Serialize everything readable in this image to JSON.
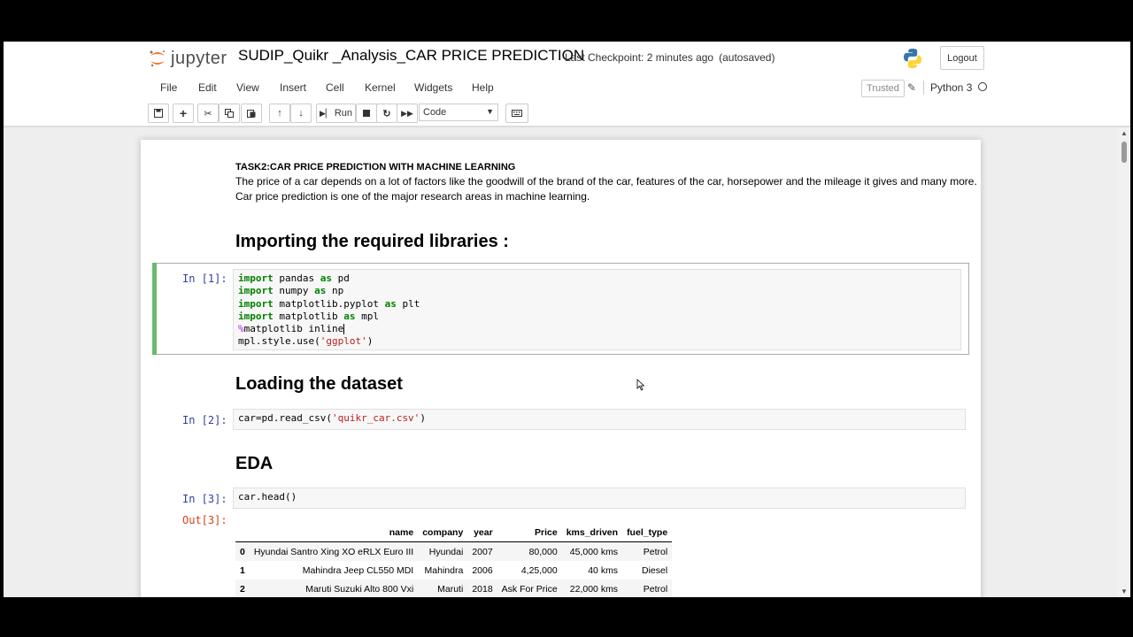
{
  "header": {
    "logo_text": "jupyter",
    "notebook_title": "SUDIP_Quikr _Analysis_CAR PRICE PREDICTION",
    "checkpoint": "Last Checkpoint: 2 minutes ago",
    "autosave": "(autosaved)",
    "logout_label": "Logout"
  },
  "menubar": {
    "items": [
      "File",
      "Edit",
      "View",
      "Insert",
      "Cell",
      "Kernel",
      "Widgets",
      "Help"
    ],
    "trusted_label": "Trusted",
    "kernel_name": "Python 3"
  },
  "toolbar": {
    "run_label": "Run",
    "cell_type": "Code"
  },
  "notebook": {
    "task_heading": "TASK2:CAR PRICE PREDICTION WITH MACHINE LEARNING",
    "intro_line1": "The price of a car depends on a lot of factors like the goodwill of the brand of the car, features of the car, horsepower and the mileage it gives and many more.",
    "intro_line2": "Car price prediction is one of the major research areas in machine learning.",
    "section1": "Importing the required libraries :",
    "section2": "Loading the dataset",
    "section3": "EDA",
    "cells": [
      {
        "prompt": "In [1]:"
      },
      {
        "prompt": "In [2]:"
      },
      {
        "prompt": "In [3]:"
      }
    ],
    "out_prompt": "Out[3]:",
    "code1": {
      "l1_kw1": "import",
      "l1_mod": " pandas ",
      "l1_kw2": "as",
      "l1_alias": " pd",
      "l2_kw1": "import",
      "l2_mod": " numpy ",
      "l2_kw2": "as",
      "l2_alias": " np",
      "l3_kw1": "import",
      "l3_mod": " matplotlib.pyplot ",
      "l3_kw2": "as",
      "l3_alias": " plt",
      "l4_kw1": "import",
      "l4_mod": " matplotlib ",
      "l4_kw2": "as",
      "l4_alias": " mpl",
      "l5_magic": "%",
      "l5_rest": "matplotlib inline",
      "l6_pre": "mpl.style.use(",
      "l6_str": "'ggplot'",
      "l6_post": ")"
    },
    "code2": {
      "pre": "car=pd.read_csv(",
      "str": "'quikr_car.csv'",
      "post": ")"
    },
    "code3": {
      "text": "car.head()"
    }
  },
  "dataframe": {
    "columns": [
      "",
      "name",
      "company",
      "year",
      "Price",
      "kms_driven",
      "fuel_type"
    ],
    "rows": [
      [
        "0",
        "Hyundai Santro Xing XO eRLX Euro III",
        "Hyundai",
        "2007",
        "80,000",
        "45,000 kms",
        "Petrol"
      ],
      [
        "1",
        "Mahindra Jeep CL550 MDI",
        "Mahindra",
        "2006",
        "4,25,000",
        "40 kms",
        "Diesel"
      ],
      [
        "2",
        "Maruti Suzuki Alto 800 Vxi",
        "Maruti",
        "2018",
        "Ask For Price",
        "22,000 kms",
        "Petrol"
      ]
    ]
  },
  "colors": {
    "jupyter_orange": "#f37726",
    "prompt_in": "#303f9f",
    "prompt_out": "#d84315",
    "selected_cell": "#66bb6a"
  }
}
